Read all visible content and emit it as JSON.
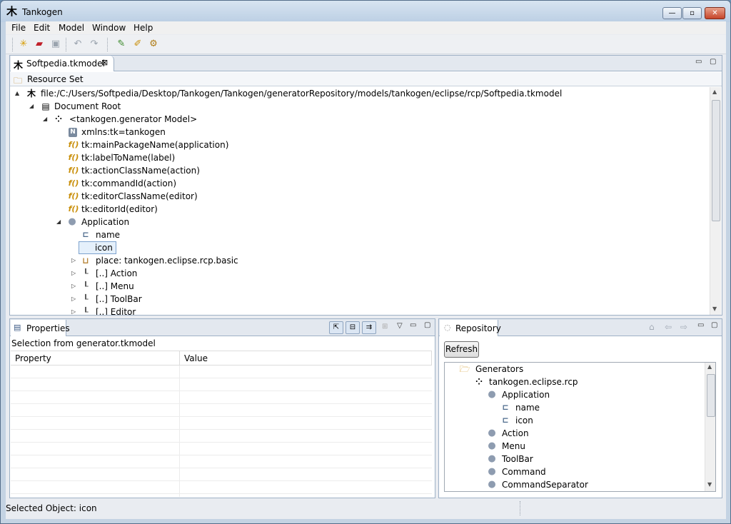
{
  "window": {
    "title": "Tankogen",
    "min_glyph": "—",
    "max_glyph": "▫",
    "close_glyph": "✕"
  },
  "menu": [
    "File",
    "Edit",
    "Model",
    "Window",
    "Help"
  ],
  "toolbar_icons": [
    "new-icon",
    "open-icon",
    "save-icon",
    "undo-icon",
    "redo-icon",
    "generate-icon",
    "edit-generator-icon",
    "settings-icon"
  ],
  "editor": {
    "tab_label": "Softpedia.tkmodel",
    "close_glyph": "⊠",
    "resource_set_label": "Resource Set",
    "tree": [
      {
        "label": "file:/C:/Users/Softpedia/Desktop/Tankogen/Tankogen/generatorRepository/models/tankogen/eclipse/rcp/Softpedia.tkmodel",
        "icon": "tankogen-icon",
        "glyph": "木",
        "twisty": "▲"
      },
      {
        "label": "Document Root",
        "icon": "document-root-icon",
        "glyph": "▤",
        "twisty": "◢"
      },
      {
        "label": "<tankogen.generator Model>",
        "icon": "model-icon",
        "glyph": "⁘",
        "twisty": "◢"
      },
      {
        "label": "xmlns:tk=tankogen",
        "icon": "namespace-icon",
        "glyph": "N"
      },
      {
        "label": "tk:mainPackageName(application)",
        "icon": "function-icon",
        "glyph": "f()"
      },
      {
        "label": "tk:labelToName(label)",
        "icon": "function-icon",
        "glyph": "f()"
      },
      {
        "label": "tk:actionClassName(action)",
        "icon": "function-icon",
        "glyph": "f()"
      },
      {
        "label": "tk:commandId(action)",
        "icon": "function-icon",
        "glyph": "f()"
      },
      {
        "label": "tk:editorClassName(editor)",
        "icon": "function-icon",
        "glyph": "f()"
      },
      {
        "label": "tk:editorId(editor)",
        "icon": "function-icon",
        "glyph": "f()"
      },
      {
        "label": "Application",
        "icon": "element-icon",
        "glyph": "●",
        "twisty": "◢"
      },
      {
        "label": "name",
        "icon": "attribute-icon",
        "glyph": "⊏"
      },
      {
        "label": "icon",
        "icon": "attribute-icon",
        "glyph": "⊏"
      },
      {
        "label": "place: tankogen.eclipse.rcp.basic",
        "icon": "place-icon",
        "glyph": "⊔",
        "twisty": "▷"
      },
      {
        "label": "[..] Action",
        "icon": "reference-icon",
        "glyph": "┖",
        "twisty": "▷"
      },
      {
        "label": "[..] Menu",
        "icon": "reference-icon",
        "glyph": "┖",
        "twisty": "▷"
      },
      {
        "label": "[..] ToolBar",
        "icon": "reference-icon",
        "glyph": "┖",
        "twisty": "▷"
      },
      {
        "label": "[..] Editor",
        "icon": "reference-icon",
        "glyph": "┖",
        "twisty": "▷"
      }
    ]
  },
  "properties": {
    "tab_label": "Properties",
    "selection_label": "Selection from generator.tkmodel",
    "columns": [
      "Property",
      "Value"
    ],
    "rows": [
      [
        "",
        ""
      ],
      [
        "",
        ""
      ],
      [
        "",
        ""
      ],
      [
        "",
        ""
      ],
      [
        "",
        ""
      ],
      [
        "",
        ""
      ],
      [
        "",
        ""
      ],
      [
        "",
        ""
      ],
      [
        "",
        ""
      ],
      [
        "",
        ""
      ]
    ]
  },
  "repository": {
    "tab_label": "Repository",
    "refresh_label": "Refresh",
    "tree": [
      {
        "label": "Generators",
        "icon": "folder-open-icon",
        "glyph": "📂",
        "indent": 0
      },
      {
        "label": "tankogen.eclipse.rcp",
        "icon": "model-icon",
        "glyph": "⁘",
        "indent": 1
      },
      {
        "label": "Application",
        "icon": "element-icon",
        "glyph": "●",
        "indent": 2
      },
      {
        "label": "name",
        "icon": "attribute-icon",
        "glyph": "⊏",
        "indent": 3
      },
      {
        "label": "icon",
        "icon": "attribute-icon",
        "glyph": "⊏",
        "indent": 3
      },
      {
        "label": "Action",
        "icon": "element-icon",
        "glyph": "●",
        "indent": 2
      },
      {
        "label": "Menu",
        "icon": "element-icon",
        "glyph": "●",
        "indent": 2
      },
      {
        "label": "ToolBar",
        "icon": "element-icon",
        "glyph": "●",
        "indent": 2
      },
      {
        "label": "Command",
        "icon": "element-icon",
        "glyph": "●",
        "indent": 2
      },
      {
        "label": "CommandSeparator",
        "icon": "element-icon",
        "glyph": "●",
        "indent": 2
      }
    ]
  },
  "status": {
    "text": "Selected Object: icon"
  }
}
